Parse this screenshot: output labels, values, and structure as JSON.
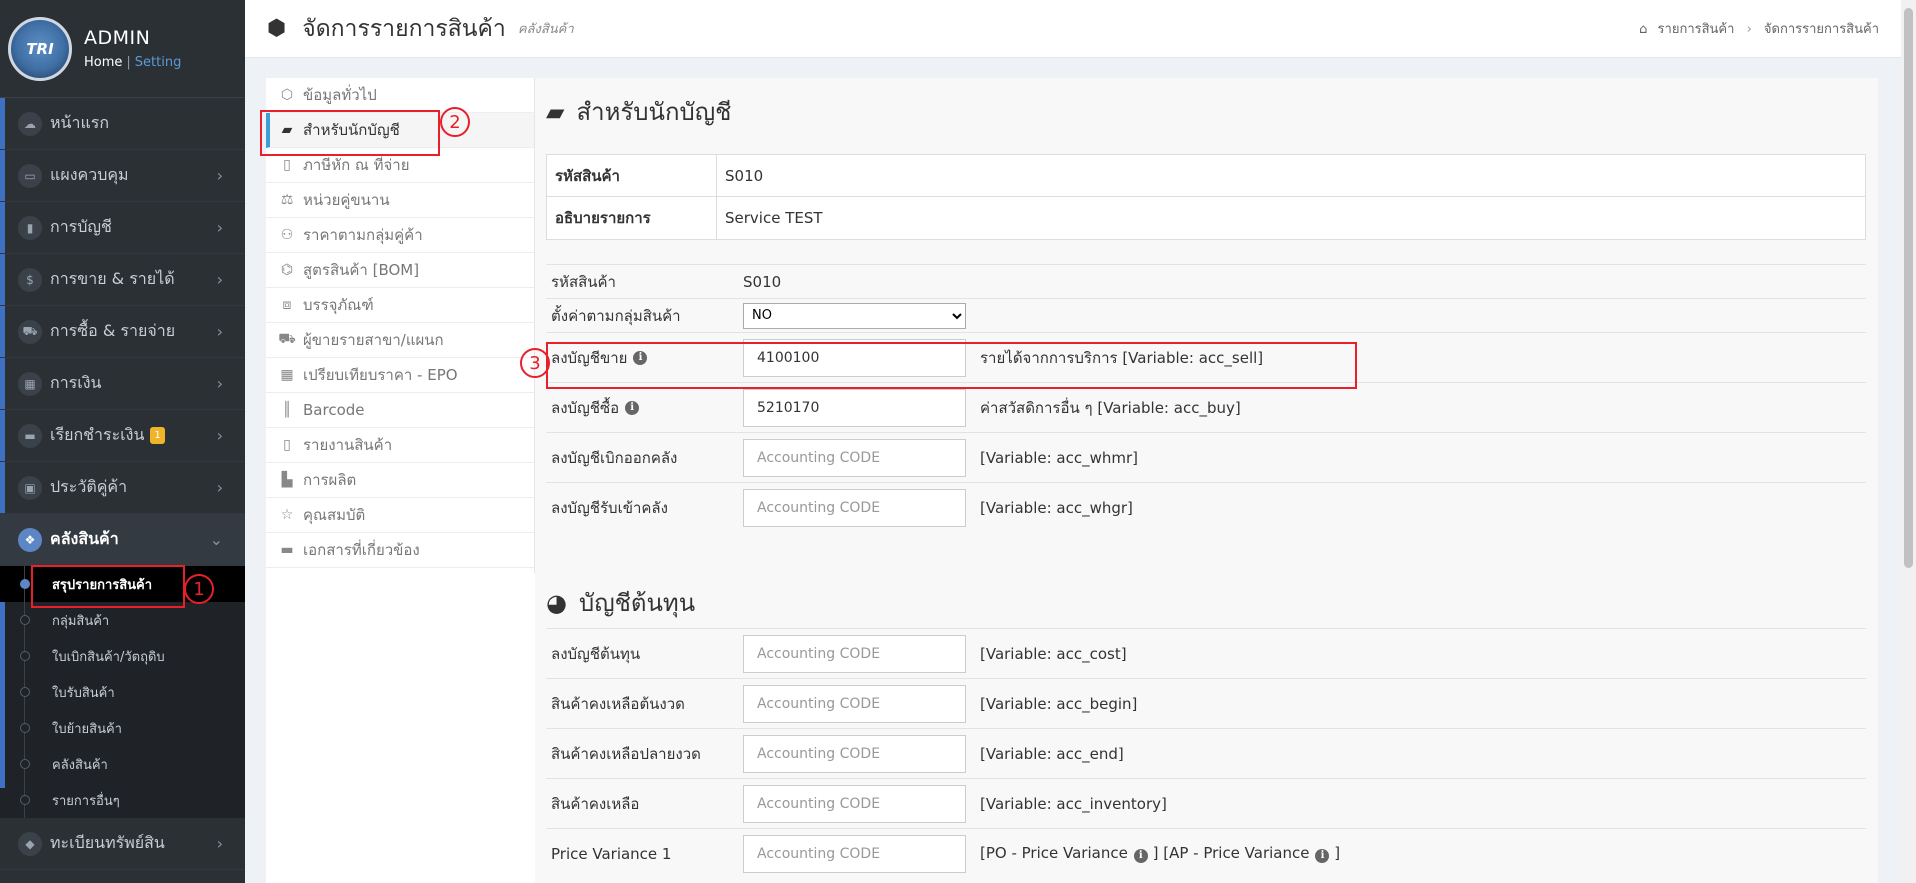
{
  "sidebar": {
    "logo_text": "TRI",
    "user": "ADMIN",
    "home_link": "Home",
    "separator": "|",
    "setting_link": "Setting",
    "items": [
      {
        "label": "หน้าแรก",
        "icon": "cloud-icon"
      },
      {
        "label": "แผงควบคุม",
        "icon": "monitor-icon"
      },
      {
        "label": "การบัญชี",
        "icon": "book-icon"
      },
      {
        "label": "การขาย & รายได้",
        "icon": "dollar-icon"
      },
      {
        "label": "การซื้อ & รายจ่าย",
        "icon": "cart-icon"
      },
      {
        "label": "การเงิน",
        "icon": "calendar-icon"
      },
      {
        "label": "เรียกชำระเงิน",
        "icon": "card-icon",
        "badge": "1"
      },
      {
        "label": "ประวัติคู่ค้า",
        "icon": "contact-icon"
      },
      {
        "label": "คลังสินค้า",
        "icon": "cubes-icon"
      }
    ],
    "sub_items": [
      "สรุปรายการสินค้า",
      "กลุ่มสินค้า",
      "ใบเบิกสินค้า/วัตถุดิบ",
      "ใบรับสินค้า",
      "ใบย้ายสินค้า",
      "คลังสินค้า",
      "รายการอื่นๆ"
    ],
    "last_item": {
      "label": "ทะเบียนทรัพย์สิน",
      "icon": "diamond-icon"
    }
  },
  "topbar": {
    "title": "จัดการรายการสินค้า",
    "subtitle": "คลังสินค้า",
    "breadcrumb": [
      "รายการสินค้า",
      "จัดการรายการสินค้า"
    ]
  },
  "tabs": [
    "ข้อมูลทั่วไป",
    "สำหรับนักบัญชี",
    "ภาษีหัก ณ ที่จ่าย",
    "หน่วยคู่ขนาน",
    "ราคาตามกลุ่มคู่ค้า",
    "สูตรสินค้า [BOM]",
    "บรรจุภัณฑ์",
    "ผู้ขายรายสาขา/แผนก",
    "เปรียบเทียบราคา - EPO",
    "Barcode",
    "รายงานสินค้า",
    "การผลิต",
    "คุณสมบัติ",
    "เอกสารที่เกี่ยวข้อง"
  ],
  "accounting": {
    "title": "สำหรับนักบัญชี",
    "info": [
      {
        "label": "รหัสสินค้า",
        "value": "S010"
      },
      {
        "label": "อธิบายรายการ",
        "value": "Service TEST"
      }
    ],
    "code_label": "รหัสสินค้า",
    "code_value": "S010",
    "group_label": "ตั้งค่าตามกลุ่มสินค้า",
    "group_value": "NO",
    "rows": [
      {
        "label": "ลงบัญชีขาย",
        "value": "4100100",
        "placeholder": "Accounting CODE",
        "desc": "รายได้จากการบริการ [Variable: acc_sell]"
      },
      {
        "label": "ลงบัญชีซื้อ",
        "value": "5210170",
        "placeholder": "Accounting CODE",
        "desc": "ค่าสวัสดิการอื่น ๆ [Variable: acc_buy]"
      },
      {
        "label": "ลงบัญชีเบิกออกคลัง",
        "value": "",
        "placeholder": "Accounting CODE",
        "desc": "[Variable: acc_whmr]"
      },
      {
        "label": "ลงบัญชีรับเข้าคลัง",
        "value": "",
        "placeholder": "Accounting CODE",
        "desc": "[Variable: acc_whgr]"
      }
    ]
  },
  "cost": {
    "title": "บัญชีต้นทุน",
    "rows": [
      {
        "label": "ลงบัญชีต้นทุน",
        "placeholder": "Accounting CODE",
        "desc": "[Variable: acc_cost]"
      },
      {
        "label": "สินค้าคงเหลือต้นงวด",
        "placeholder": "Accounting CODE",
        "desc": "[Variable: acc_begin]"
      },
      {
        "label": "สินค้าคงเหลือปลายงวด",
        "placeholder": "Accounting CODE",
        "desc": "[Variable: acc_end]"
      },
      {
        "label": "สินค้าคงเหลือ",
        "placeholder": "Accounting CODE",
        "desc": "[Variable: acc_inventory]"
      },
      {
        "label": "Price Variance 1",
        "placeholder": "Accounting CODE",
        "desc_a": "[PO - Price Variance",
        "desc_b": "] [AP - Price Variance",
        "desc_c": "]"
      }
    ]
  },
  "annotations": [
    "1",
    "2",
    "3"
  ],
  "colors": {
    "sidebar": "#2b3035",
    "accent": "#3e70c4",
    "annotation": "#e8202a"
  }
}
